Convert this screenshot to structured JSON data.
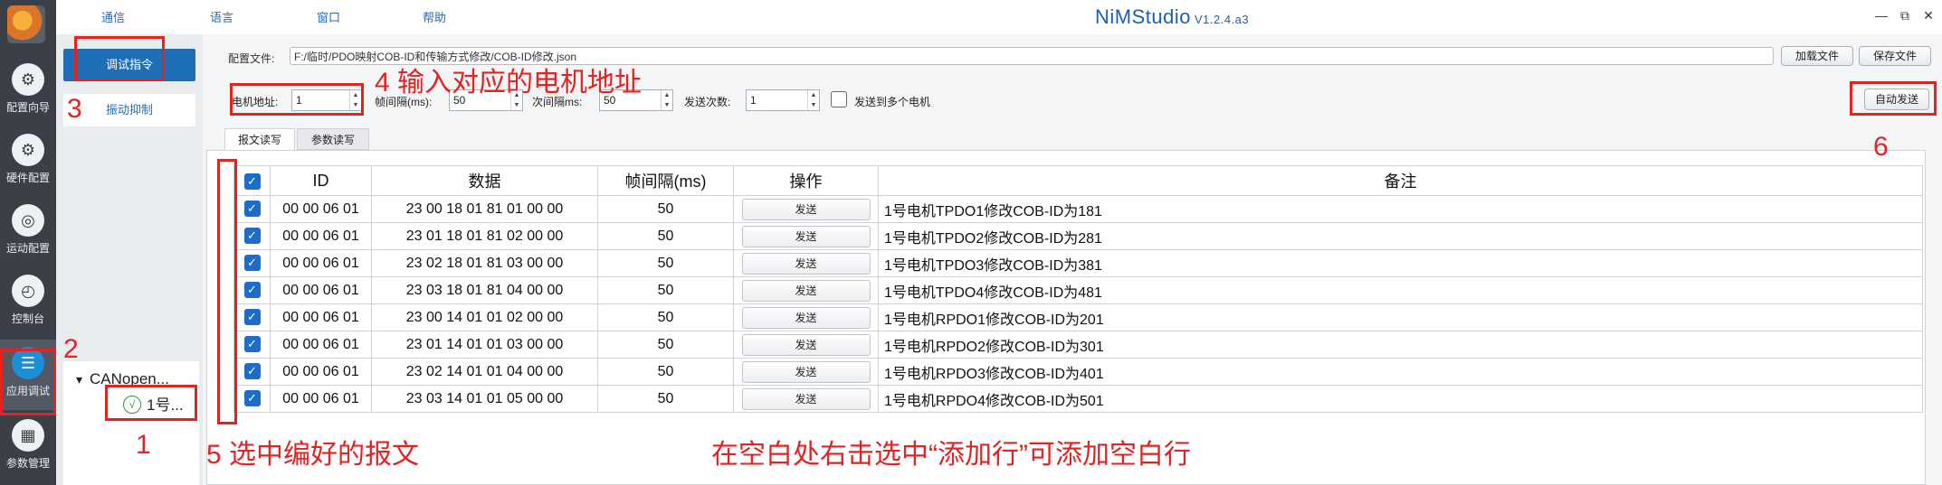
{
  "menu": {
    "items": [
      "通信",
      "语言",
      "窗口",
      "帮助"
    ]
  },
  "app": {
    "title": "NiMStudio",
    "version": "V1.2.4.a3",
    "min": "—",
    "restore": "⧉",
    "close": "✕"
  },
  "rail": {
    "items": [
      {
        "label": "配置向导",
        "icon": "wizard-icon",
        "glyph": "⚙"
      },
      {
        "label": "硬件配置",
        "icon": "hardware-icon",
        "glyph": "⚙"
      },
      {
        "label": "运动配置",
        "icon": "motion-icon",
        "glyph": "◎"
      },
      {
        "label": "控制台",
        "icon": "console-icon",
        "glyph": "◴"
      },
      {
        "label": "应用调试",
        "icon": "app-debug-icon",
        "glyph": "☰"
      },
      {
        "label": "参数管理",
        "icon": "param-icon",
        "glyph": "▦"
      }
    ]
  },
  "leftpanel": {
    "cmd_label": "调试指令",
    "sub_label": "振动抑制",
    "tree_root": "CANopen...",
    "tree_arrow": "▾",
    "tree_child": "1号...",
    "tree_check": "√"
  },
  "config": {
    "label": "配置文件:",
    "path": "F:/临时/PDO映射COB-ID和传输方式修改/COB-ID修改.json",
    "load_label": "加载文件",
    "save_label": "保存文件"
  },
  "params": {
    "motor_addr_label": "电机地址:",
    "motor_addr": "1",
    "frame_interval_label": "帧间隔(ms):",
    "frame_interval": "50",
    "interval_label": "次间隔ms:",
    "interval": "50",
    "send_count_label": "发送次数:",
    "send_count": "1",
    "multi_label": "发送到多个电机",
    "auto_send_label": "自动发送",
    "up": "▲",
    "down": "▼"
  },
  "tabs": [
    "报文读写",
    "参数读写"
  ],
  "table": {
    "headers": [
      "ID",
      "数据",
      "帧间隔(ms)",
      "操作",
      "备注"
    ],
    "check_glyph": "✓",
    "rows": [
      {
        "id": "00 00 06 01",
        "data": "23 00 18 01 81 01 00 00",
        "interval": "50",
        "op": "发送",
        "note": "1号电机TPDO1修改COB-ID为181"
      },
      {
        "id": "00 00 06 01",
        "data": "23 01 18 01 81 02 00 00",
        "interval": "50",
        "op": "发送",
        "note": "1号电机TPDO2修改COB-ID为281"
      },
      {
        "id": "00 00 06 01",
        "data": "23 02 18 01 81 03 00 00",
        "interval": "50",
        "op": "发送",
        "note": "1号电机TPDO3修改COB-ID为381"
      },
      {
        "id": "00 00 06 01",
        "data": "23 03 18 01 81 04 00 00",
        "interval": "50",
        "op": "发送",
        "note": "1号电机TPDO4修改COB-ID为481"
      },
      {
        "id": "00 00 06 01",
        "data": "23 00 14 01 01 02 00 00",
        "interval": "50",
        "op": "发送",
        "note": "1号电机RPDO1修改COB-ID为201"
      },
      {
        "id": "00 00 06 01",
        "data": "23 01 14 01 01 03 00 00",
        "interval": "50",
        "op": "发送",
        "note": "1号电机RPDO2修改COB-ID为301"
      },
      {
        "id": "00 00 06 01",
        "data": "23 02 14 01 01 04 00 00",
        "interval": "50",
        "op": "发送",
        "note": "1号电机RPDO3修改COB-ID为401"
      },
      {
        "id": "00 00 06 01",
        "data": "23 03 14 01 01 05 00 00",
        "interval": "50",
        "op": "发送",
        "note": "1号电机RPDO4修改COB-ID为501"
      }
    ]
  },
  "annotations": {
    "n1": "1",
    "n2": "2",
    "n3": "3",
    "n4": "4 输入对应的电机地址",
    "n5": "5 选中编好的报文",
    "n6": "6",
    "hint": "在空白处右击选中“添加行”可添加空白行",
    "color": "#e32222"
  }
}
